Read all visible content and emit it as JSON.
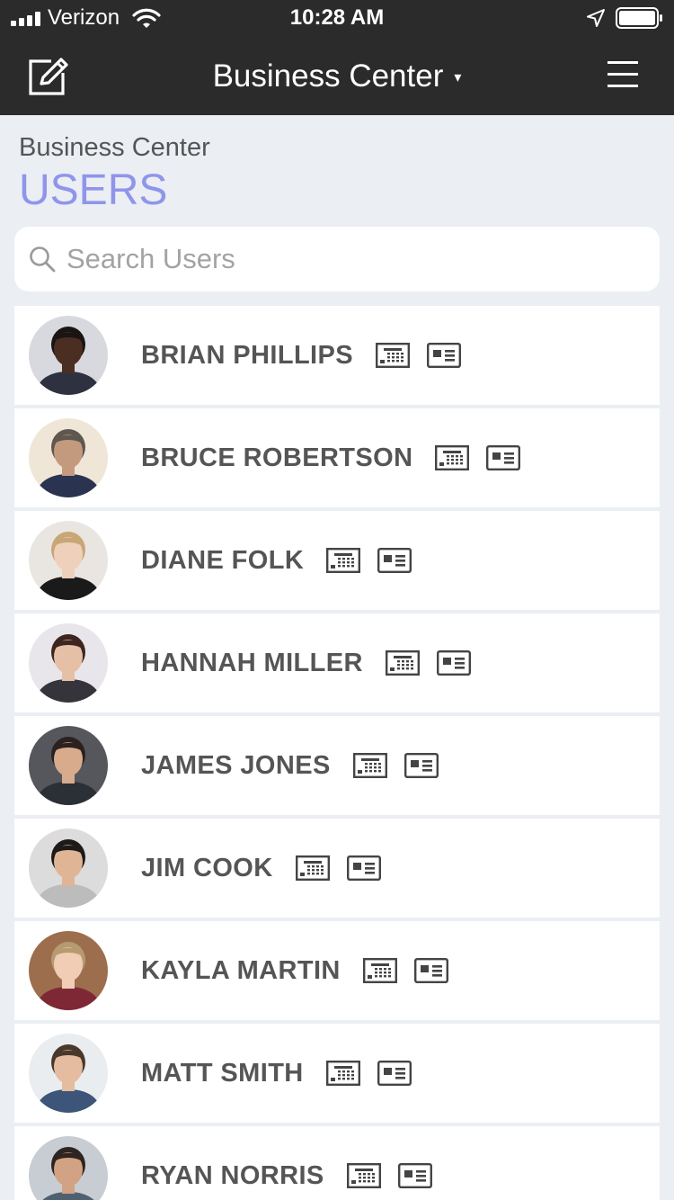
{
  "status_bar": {
    "carrier": "Verizon",
    "time": "10:28 AM"
  },
  "nav": {
    "title": "Business Center",
    "caret": "▾"
  },
  "header": {
    "breadcrumb": "Business Center",
    "title": "USERS"
  },
  "search": {
    "placeholder": "Search Users"
  },
  "users": [
    {
      "name": "BRIAN PHILLIPS",
      "skin": "#4a2e22",
      "hair": "#1a1413",
      "shirt": "#2d3140",
      "bg": "#d7d9de"
    },
    {
      "name": "BRUCE ROBERTSON",
      "skin": "#c49a7e",
      "hair": "#5e5850",
      "shirt": "#2a3450",
      "bg": "#f0e6d8"
    },
    {
      "name": "DIANE FOLK",
      "skin": "#efd0ba",
      "hair": "#c9a676",
      "shirt": "#1a1a1a",
      "bg": "#e9e6e2"
    },
    {
      "name": "HANNAH MILLER",
      "skin": "#e6bfa7",
      "hair": "#3d2620",
      "shirt": "#34343a",
      "bg": "#e8e6ea"
    },
    {
      "name": "JAMES JONES",
      "skin": "#d8ab8d",
      "hair": "#2b2220",
      "shirt": "#2b2f36",
      "bg": "#55575c"
    },
    {
      "name": "JIM COOK",
      "skin": "#dfb595",
      "hair": "#1d1a18",
      "shirt": "#bcbcbc",
      "bg": "#dcdcdc"
    },
    {
      "name": "KAYLA MARTIN",
      "skin": "#f1cdb5",
      "hair": "#b69a70",
      "shirt": "#7e2836",
      "bg": "#9c6e4e"
    },
    {
      "name": "MATT SMITH",
      "skin": "#e5bc9f",
      "hair": "#4a382b",
      "shirt": "#3c5578",
      "bg": "#e9edf0"
    },
    {
      "name": "RYAN NORRIS",
      "skin": "#d1a283",
      "hair": "#2e2420",
      "shirt": "#4f6170",
      "bg": "#c7cdd2"
    }
  ],
  "icons": {
    "left": "building-icon",
    "right": "contact-card-icon"
  },
  "colors": {
    "nav_bg": "#2b2b2b",
    "accent": "#8f95ea",
    "page_bg": "#ebeef3"
  }
}
